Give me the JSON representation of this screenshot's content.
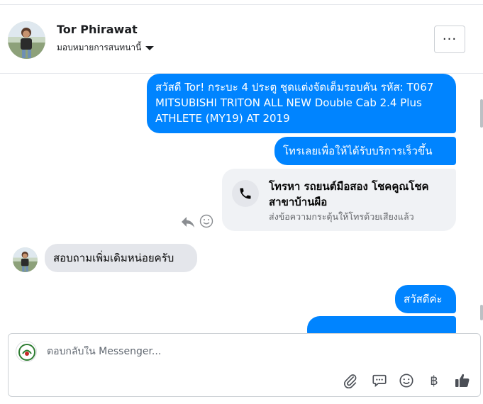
{
  "header": {
    "name": "Tor Phirawat",
    "assign_label": "มอบหมายการสนทนานี้",
    "more_label": "···"
  },
  "messages": {
    "out_1": "สวัสดี Tor! กระบะ 4 ประตู ชุดแต่งจัดเต็มรอบคัน รหัส: T067 MITSUBISHI TRITON ALL NEW Double Cab 2.4 Plus ATHLETE (MY19) AT 2019",
    "out_2": "โทรเลยเพื่อให้ได้รับบริการเร็วขึ้น",
    "call_card": {
      "title": "โทรหา รถยนต์มือสอง โชคคูณโชค สาขาบ้านผือ",
      "subtitle": "ส่งข้อความกระตุ้นให้โทรด้วยเสียงแล้ว"
    },
    "in_1": "สอบถามเพิ่มเดิมหน่อยครับ",
    "out_3": "สวัสดีค่ะ"
  },
  "composer": {
    "placeholder": "ตอบกลับใน Messenger...",
    "tools": [
      "paperclip-icon",
      "speech-bubble-icon",
      "emoji-icon",
      "baht-icon",
      "like-icon"
    ],
    "baht_symbol": "฿"
  },
  "colors": {
    "outgoing_bubble": "#0084ff",
    "incoming_bubble": "#e4e6eb",
    "icon_gray": "#4b4f56"
  }
}
